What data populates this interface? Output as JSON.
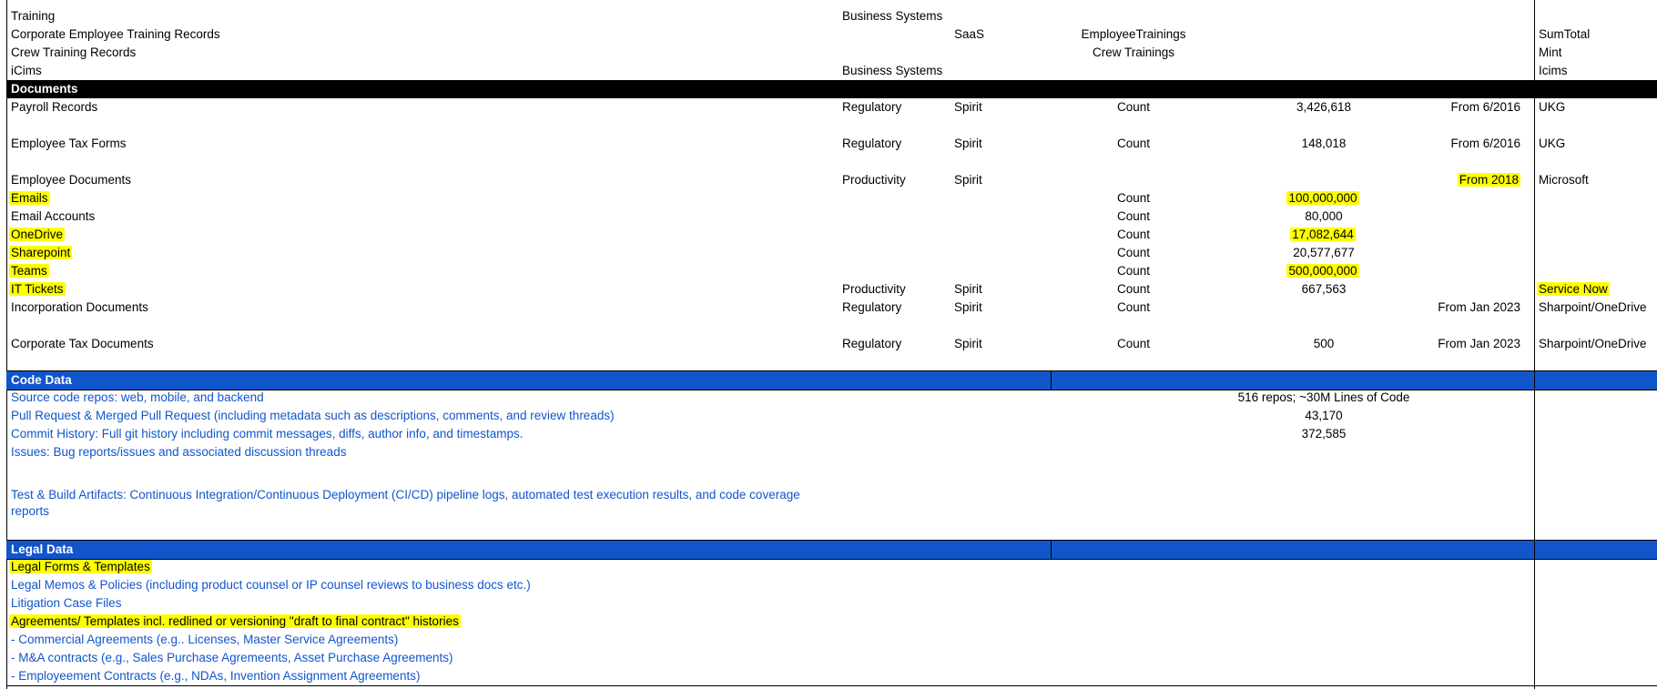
{
  "top_rows": [
    {
      "name": "Training",
      "category": "Business Systems",
      "source": "",
      "metric": "",
      "value": "",
      "range": "",
      "system": ""
    },
    {
      "name": "Corporate Employee Training Records",
      "category": "",
      "source": "SaaS",
      "metric": "EmployeeTrainings",
      "value": "",
      "range": "",
      "system": "SumTotal"
    },
    {
      "name": "Crew Training Records",
      "category": "",
      "source": "",
      "metric": "Crew Trainings",
      "value": "",
      "range": "",
      "system": "Mint"
    },
    {
      "name": "iCims",
      "category": "Business Systems",
      "source": "",
      "metric": "",
      "value": "",
      "range": "",
      "system": "Icims"
    }
  ],
  "documents": {
    "header": "Documents",
    "rows": [
      {
        "name": "Payroll Records",
        "category": "Regulatory",
        "source": "Spirit",
        "metric": "Count",
        "value": "3,426,618",
        "range": "From 6/2016",
        "system": "UKG"
      },
      {
        "name": "Employee Tax Forms",
        "category": "Regulatory",
        "source": "Spirit",
        "metric": "Count",
        "value": "148,018",
        "range": "From 6/2016",
        "system": "UKG"
      },
      {
        "name": "Employee Documents",
        "category": "Productivity",
        "source": "Spirit",
        "metric": "",
        "value": "",
        "range": "From 2018",
        "system": "Microsoft"
      },
      {
        "name": "Emails",
        "category": "",
        "source": "",
        "metric": "Count",
        "value": "100,000,000",
        "range": "",
        "system": ""
      },
      {
        "name": "Email Accounts",
        "category": "",
        "source": "",
        "metric": "Count",
        "value": "80,000",
        "range": "",
        "system": ""
      },
      {
        "name": "OneDrive",
        "category": "",
        "source": "",
        "metric": "Count",
        "value": "17,082,644",
        "range": "",
        "system": ""
      },
      {
        "name": "Sharepoint",
        "category": "",
        "source": "",
        "metric": "Count",
        "value": "20,577,677",
        "range": "",
        "system": ""
      },
      {
        "name": "Teams",
        "category": "",
        "source": "",
        "metric": "Count",
        "value": "500,000,000",
        "range": "",
        "system": ""
      },
      {
        "name": "IT Tickets",
        "category": "Productivity",
        "source": "Spirit",
        "metric": "Count",
        "value": "667,563",
        "range": "",
        "system": "Service Now"
      },
      {
        "name": "Incorporation Documents",
        "category": "Regulatory",
        "source": "Spirit",
        "metric": "Count",
        "value": "",
        "range": "From Jan 2023",
        "system": "Sharpoint/OneDrive"
      },
      {
        "name": "Corporate Tax Documents",
        "category": "Regulatory",
        "source": "Spirit",
        "metric": "Count",
        "value": "500",
        "range": "From Jan 2023",
        "system": "Sharpoint/OneDrive"
      }
    ]
  },
  "code_data": {
    "header": "Code Data",
    "rows": [
      {
        "name": "Source code repos: web, mobile, and backend",
        "value": "516 repos; ~30M Lines of Code"
      },
      {
        "name": "Pull Request & Merged Pull Request (including metadata such as descriptions, comments, and review threads)",
        "value": "43,170"
      },
      {
        "name": "Commit History: Full git history including commit messages, diffs, author info, and timestamps.",
        "value": "372,585"
      },
      {
        "name": "Issues: Bug reports/issues and associated discussion threads",
        "value": ""
      },
      {
        "name": "Test & Build Artifacts: Continuous Integration/Continuous Deployment (CI/CD) pipeline logs, automated test execution results, and code coverage reports",
        "value": ""
      }
    ]
  },
  "legal_data": {
    "header": "Legal Data",
    "rows": [
      {
        "name": "Legal Forms & Templates"
      },
      {
        "name": "Legal Memos & Policies (including product counsel or IP counsel reviews to business docs etc.)"
      },
      {
        "name": "Litigation Case Files"
      },
      {
        "name": "Agreements/ Templates incl. redlined or versioning \"draft to final contract\" histories"
      },
      {
        "name": "- Commercial Agreements (e.g.. Licenses, Master Service Agreements)"
      },
      {
        "name": "- M&A contracts (e.g., Sales Purchase Agremeents, Asset Purchase Agreements)"
      },
      {
        "name": "- Employeement Contracts (e.g., NDAs, Invention Assignment Agreements)"
      }
    ]
  },
  "colors": {
    "highlight": "#ffff00",
    "section_blue": "#1155cc",
    "text_blue": "#1155cc"
  }
}
